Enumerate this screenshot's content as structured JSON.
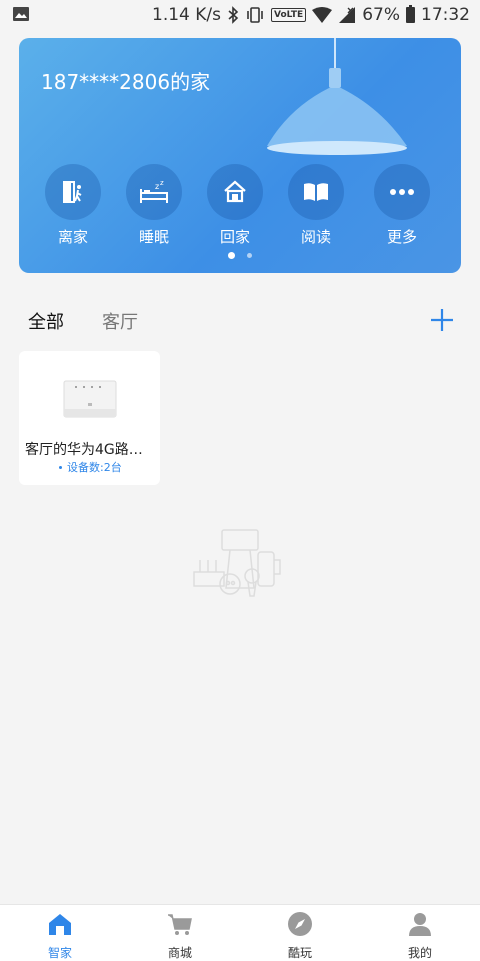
{
  "status_bar": {
    "speed": "1.14 K/s",
    "volte": "VoLTE",
    "battery": "67%",
    "time": "17:32"
  },
  "home_card": {
    "title": "187****2806的家",
    "scenes": [
      {
        "label": "离家",
        "icon": "leave-home-icon"
      },
      {
        "label": "睡眠",
        "icon": "sleep-icon"
      },
      {
        "label": "回家",
        "icon": "return-home-icon"
      },
      {
        "label": "阅读",
        "icon": "reading-icon"
      },
      {
        "label": "更多",
        "icon": "more-icon"
      }
    ],
    "page_indicator": {
      "current": 1,
      "total": 2
    }
  },
  "room_tabs": [
    {
      "label": "全部",
      "active": true
    },
    {
      "label": "客厅",
      "active": false
    }
  ],
  "devices": [
    {
      "name": "客厅的华为4G路由...",
      "count_text": "设备数:2台",
      "icon": "router-icon"
    }
  ],
  "bottom_nav": [
    {
      "label": "智家",
      "icon": "home-icon",
      "active": true
    },
    {
      "label": "商城",
      "icon": "cart-icon",
      "active": false
    },
    {
      "label": "酷玩",
      "icon": "compass-icon",
      "active": false
    },
    {
      "label": "我的",
      "icon": "user-icon",
      "active": false
    }
  ],
  "colors": {
    "accent": "#2f86e8",
    "card_gradient_start": "#5bb0ea",
    "card_gradient_end": "#3d8fe6"
  }
}
